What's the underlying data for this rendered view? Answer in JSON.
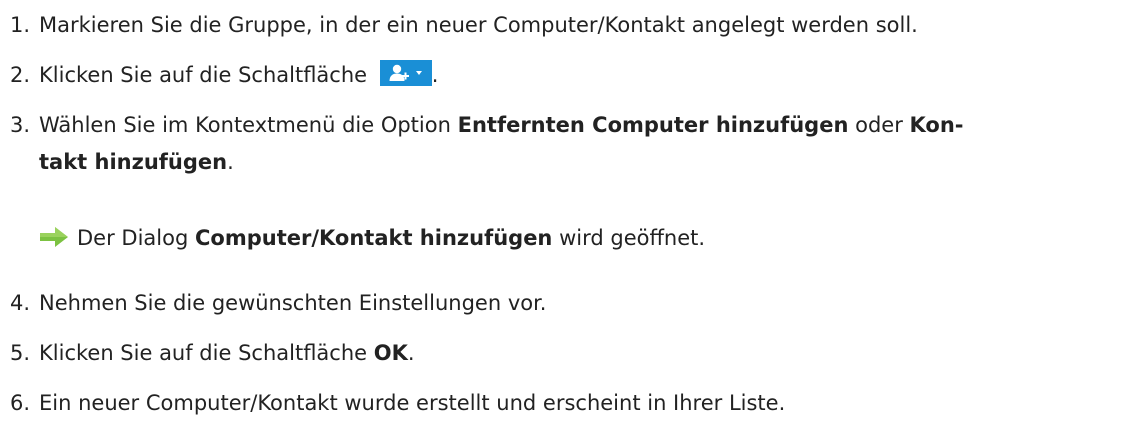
{
  "steps": [
    {
      "num": "1.",
      "text": "Markieren Sie die Gruppe, in der ein neuer Computer/Kontakt angelegt werden soll."
    },
    {
      "num": "2.",
      "pre": "Klicken Sie auf die Schaltfläche",
      "post": ".",
      "button_icon": "add-contact-dropdown-icon"
    },
    {
      "num": "3.",
      "line1_pre": "Wählen Sie im Kontextmenü die Option",
      "line1_bold": "Entfernten Computer hinzufügen",
      "line1_mid": "oder",
      "line1_bold2": "Kon-",
      "line2_bold": "takt hinzufügen",
      "line2_post": "."
    },
    {
      "result_icon": "green-arrow-icon",
      "pre": "Der Dialog",
      "bold": "Computer/Kontakt hinzufügen",
      "post": "wird geöffnet."
    },
    {
      "num": "4.",
      "text": "Nehmen Sie die gewünschten Einstellungen vor."
    },
    {
      "num": "5.",
      "pre": "Klicken Sie auf die Schaltfläche",
      "bold": "OK",
      "post": "."
    },
    {
      "num": "6.",
      "text": "Ein neuer Computer/Kontakt wurde erstellt und erscheint in Ihrer Liste."
    }
  ],
  "colors": {
    "button_bg": "#1a8fd6",
    "arrow_green": "#7cc242"
  }
}
